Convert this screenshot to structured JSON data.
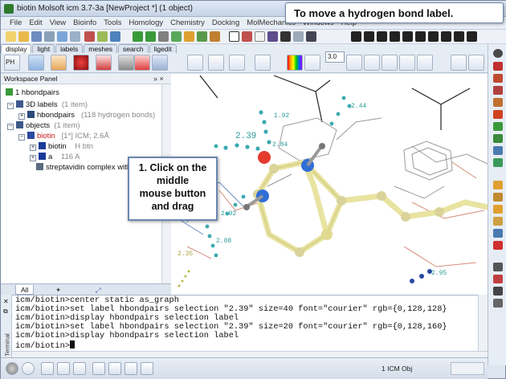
{
  "app": {
    "title": "biotin Molsoft icm 3.7-3a  [NewProject *] (1 object)"
  },
  "callouts": {
    "top": "To move a hydrogen bond label.",
    "main_lines": [
      "1. Click on the",
      "middle",
      "mouse button",
      "and drag"
    ]
  },
  "menu": [
    "File",
    "Edit",
    "View",
    "Bioinfo",
    "Tools",
    "Homology",
    "Chemistry",
    "Docking",
    "MolMechanics",
    "Windows",
    "Help"
  ],
  "tabs": [
    "display",
    "light",
    "labels",
    "meshes",
    "search",
    "ligedit"
  ],
  "toolbar": {
    "zoom_value": "3.0",
    "ph_label": "PH"
  },
  "workspace": {
    "header": "Workspace Panel",
    "controls": "» ×",
    "tree": {
      "root": "1 hbondpairs",
      "labels_group": "3D labels",
      "labels_count": "(1 item)",
      "labels_item": "hbondpairs",
      "labels_item_note": "(118 hydrogen bonds)",
      "objects_group": "objects",
      "objects_count": "(1 item)",
      "object_name": "biotin",
      "object_note": "[1*] ICM; 2.6Å",
      "child1_name": "biotin",
      "child1_note": "H   btn",
      "child2_name": "a",
      "child2_note": "116 A",
      "child3_name": "streptavidin complex with"
    },
    "bottom_tabs": [
      "All",
      "",
      ""
    ]
  },
  "viewport": {
    "distance_labels": [
      {
        "text": "1.92"
      },
      {
        "text": "2.44"
      },
      {
        "text": "2.39"
      },
      {
        "text": "2.84"
      },
      {
        "text": "2.92"
      },
      {
        "text": "2.08"
      },
      {
        "text": "2.35"
      },
      {
        "text": "2.95"
      }
    ]
  },
  "terminal": {
    "side_label": "Terminal",
    "lines": [
      "icm/biotin>center static as_graph",
      "icm/biotin>set label hbondpairs selection \"2.39\" size=40 font=\"courier\" rgb={0,128,128}",
      "icm/biotin>display hbondpairs selection label",
      "icm/biotin>set label hbondpairs selection \"2.39\" size=20 font=\"courier\" rgb={0,128,160}",
      "icm/biotin>display hbondpairs selection label",
      "icm/biotin>"
    ]
  },
  "status": {
    "objects": "1 ICM Obj"
  },
  "colors": {
    "teal_label": "#2e9a9a",
    "stick": "#e8e3a0",
    "oxygen": "#e43b2d",
    "nitrogen": "#2f6fd6"
  }
}
